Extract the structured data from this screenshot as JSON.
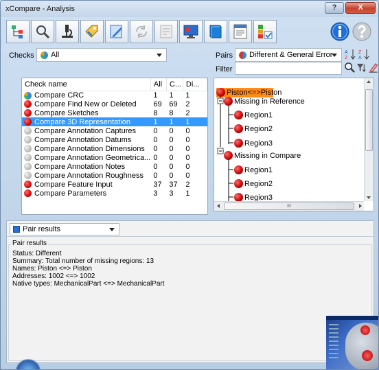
{
  "window": {
    "title": "xCompare - Analysis",
    "help_label": "?",
    "close_label": "X"
  },
  "toolbar": {
    "icons": [
      "tree-icon",
      "magnifier-icon",
      "microscope-icon",
      "tag-icon",
      "edit-icon",
      "copy-icon",
      "report-icon",
      "monitor-icon",
      "bookmark-icon",
      "report-export-icon",
      "checklist-icon"
    ],
    "info_icon": "info-icon",
    "help_icon": "help-icon"
  },
  "checks_filter": {
    "label": "Checks",
    "value": "All"
  },
  "checks_table": {
    "columns": [
      "Check name",
      "All",
      "C...",
      "Di..."
    ],
    "rows": [
      {
        "name": "Compare CRC",
        "all": "1",
        "c": "1",
        "di": "1",
        "status": "mixed"
      },
      {
        "name": "Compare Find New or Deleted",
        "all": "69",
        "c": "69",
        "di": "2",
        "status": "red"
      },
      {
        "name": "Compare Sketches",
        "all": "8",
        "c": "8",
        "di": "2",
        "status": "red"
      },
      {
        "name": "Compare 3D Representation",
        "all": "1",
        "c": "1",
        "di": "1",
        "status": "red",
        "selected": true
      },
      {
        "name": "Compare Annotation Captures",
        "all": "0",
        "c": "0",
        "di": "0",
        "status": "grey"
      },
      {
        "name": "Compare Annotation Datums",
        "all": "0",
        "c": "0",
        "di": "0",
        "status": "grey"
      },
      {
        "name": "Compare Annotation Dimensions",
        "all": "0",
        "c": "0",
        "di": "0",
        "status": "grey"
      },
      {
        "name": "Compare Annotation Geometrica...",
        "all": "0",
        "c": "0",
        "di": "0",
        "status": "grey"
      },
      {
        "name": "Compare Annotation Notes",
        "all": "0",
        "c": "0",
        "di": "0",
        "status": "grey"
      },
      {
        "name": "Compare Annotation Roughness",
        "all": "0",
        "c": "0",
        "di": "0",
        "status": "grey"
      },
      {
        "name": "Compare Feature Input",
        "all": "37",
        "c": "37",
        "di": "2",
        "status": "red"
      },
      {
        "name": "Compare Parameters",
        "all": "3",
        "c": "3",
        "di": "1",
        "status": "red"
      }
    ]
  },
  "pairs": {
    "label": "Pairs",
    "value": "Different & General Error",
    "filter_label": "Filter",
    "filter_value": ""
  },
  "tree": {
    "root": "Piston<=>Piston",
    "group1": "Missing in Reference",
    "group1_items": [
      "Region1",
      "Region2",
      "Region3"
    ],
    "group2": "Missing in Compare",
    "group2_items": [
      "Region1",
      "Region2",
      "Region3"
    ],
    "hscroll_label": "III"
  },
  "pair_results": {
    "dropdown_value": "Pair results",
    "group_title": "Pair results",
    "lines": [
      "Status: Different",
      "Summary: Total number of missing regions: 13",
      "Names: Piston <=> Piston",
      "Addresses: 1002 <=> 1002",
      "Native types: MechanicalPart <=> MechanicalPart"
    ]
  },
  "colors": {
    "selection": "#3399ff",
    "root_highlight": "#ff8c1a",
    "status_red": "#dd0000",
    "status_grey": "#b9b9b9"
  }
}
